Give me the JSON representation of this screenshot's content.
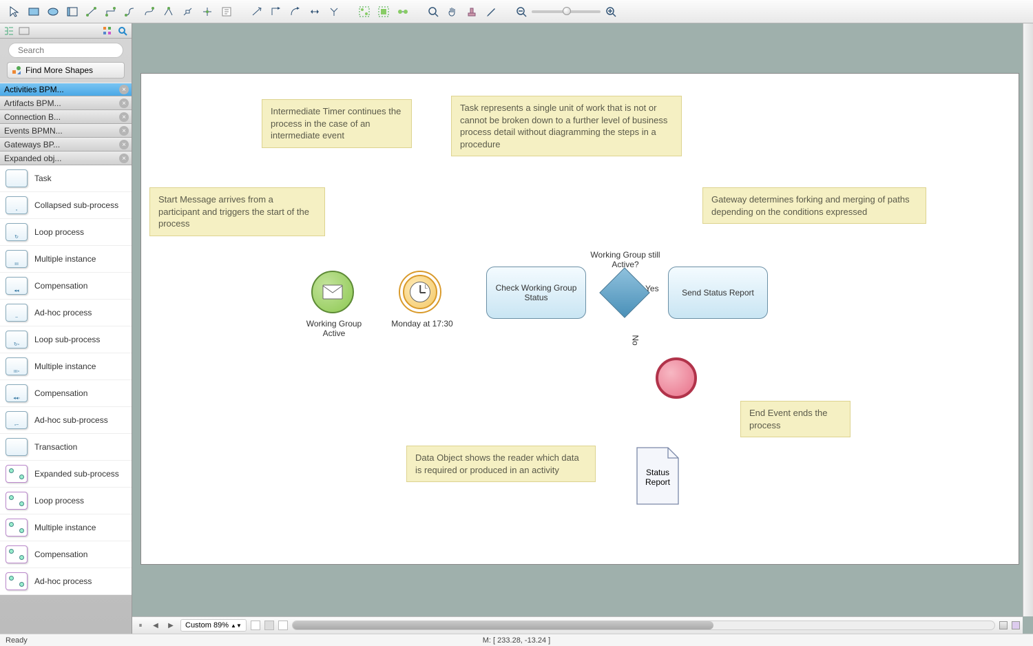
{
  "toolbar": {
    "groups": [
      [
        "pointer",
        "rect",
        "ellipse",
        "container",
        "connector-1",
        "connector-2",
        "connector-3",
        "connector-4",
        "connector-5",
        "connector-6",
        "connector-7",
        "insert"
      ],
      [
        "line-1",
        "line-2",
        "line-3",
        "line-bi",
        "line-split"
      ],
      [
        "align-1",
        "align-2",
        "align-3"
      ],
      [
        "zoom-region",
        "pan",
        "stamp",
        "eyedropper"
      ],
      [
        "zoom-out",
        "zoom-slider",
        "zoom-in"
      ]
    ]
  },
  "sidebar": {
    "search_placeholder": "Search",
    "find_more": "Find More Shapes",
    "categories": [
      {
        "label": "Activities BPM...",
        "selected": true
      },
      {
        "label": "Artifacts BPM..."
      },
      {
        "label": "Connection B..."
      },
      {
        "label": "Events BPMN..."
      },
      {
        "label": "Gateways BP..."
      },
      {
        "label": "Expanded obj..."
      }
    ],
    "shapes": [
      {
        "label": "Task",
        "badge": ""
      },
      {
        "label": "Collapsed sub-process",
        "badge": "▫"
      },
      {
        "label": "Loop process",
        "badge": "↻"
      },
      {
        "label": "Multiple instance",
        "badge": "ııı"
      },
      {
        "label": "Compensation",
        "badge": "◂◂"
      },
      {
        "label": "Ad-hoc process",
        "badge": "~"
      },
      {
        "label": "Loop sub-process",
        "badge": "↻▫"
      },
      {
        "label": "Multiple instance",
        "badge": "ııı▫"
      },
      {
        "label": "Compensation",
        "badge": "◂◂▫"
      },
      {
        "label": "Ad-hoc sub-process",
        "badge": "▫~"
      },
      {
        "label": "Transaction",
        "badge": ""
      },
      {
        "label": "Expanded sub-process",
        "badge": "",
        "exp": true
      },
      {
        "label": "Loop process",
        "badge": "",
        "exp": true
      },
      {
        "label": "Multiple instance",
        "badge": "",
        "exp": true
      },
      {
        "label": "Compensation",
        "badge": "",
        "exp": true
      },
      {
        "label": "Ad-hoc process",
        "badge": "",
        "exp": true
      }
    ]
  },
  "diagram": {
    "notes": {
      "start": "Start Message arrives from a participant and triggers the start of the process",
      "timer": "Intermediate Timer continues the process in the case of an intermediate event",
      "task": "Task represents a single unit of work that is not or cannot be broken down to a further level of business process detail without diagramming the steps in a procedure",
      "gateway": "Gateway determines forking and merging of paths depending on the conditions expressed",
      "end": "End Event ends the process",
      "data": "Data Object shows the reader which data is required or produced in an activity"
    },
    "labels": {
      "start": "Working Group Active",
      "timer": "Monday at 17:30",
      "task_check": "Check Working Group Status",
      "task_send": "Send Status Report",
      "gateway_q": "Working Group still Active?",
      "yes": "Yes",
      "no": "No",
      "data_obj": "Status Report"
    }
  },
  "bottombar": {
    "zoom_label": "Custom 89%"
  },
  "status": {
    "ready": "Ready",
    "coords": "M: [ 233.28, -13.24 ]"
  }
}
